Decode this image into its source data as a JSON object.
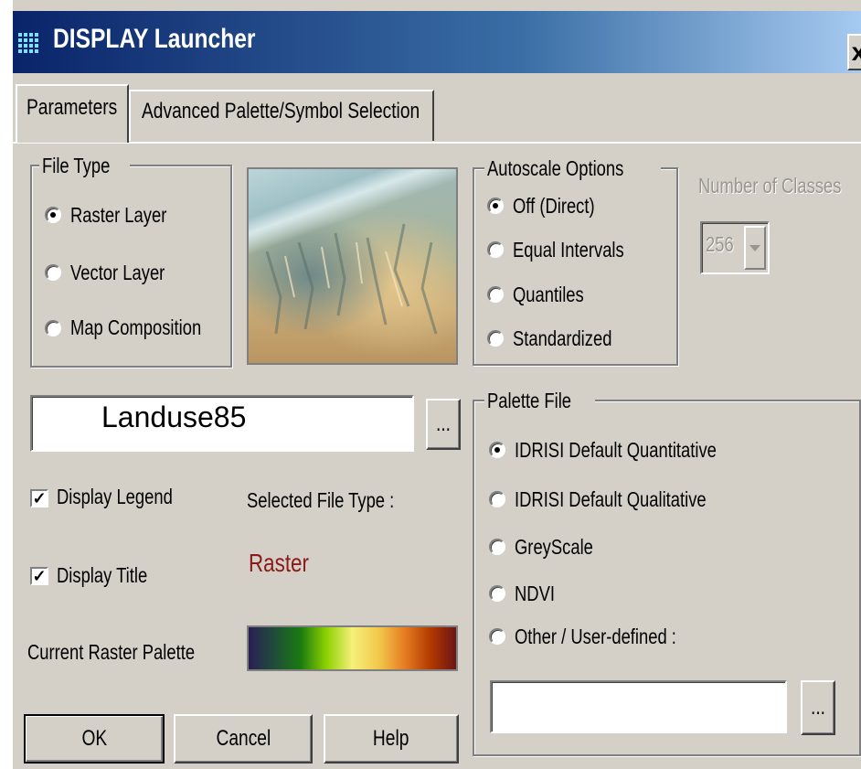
{
  "window": {
    "title": "DISPLAY Launcher",
    "close_label": "x"
  },
  "tabs": [
    {
      "label": "Parameters",
      "active": true
    },
    {
      "label": "Advanced Palette/Symbol Selection",
      "active": false
    }
  ],
  "file_type": {
    "legend": "File Type",
    "options": [
      "Raster Layer",
      "Vector Layer",
      "Map Composition"
    ],
    "selected": "Raster Layer"
  },
  "preview": {
    "icon": "terrain-thumbnail"
  },
  "autoscale": {
    "legend": "Autoscale Options",
    "options": [
      "Off (Direct)",
      "Equal Intervals",
      "Quantiles",
      "Standardized"
    ],
    "selected": "Off (Direct)"
  },
  "classes": {
    "label": "Number of Classes",
    "value": "256",
    "enabled": false
  },
  "file_input": {
    "value": "Landuse85",
    "browse_label": "..."
  },
  "display_legend": {
    "label": "Display Legend",
    "checked": true
  },
  "display_title": {
    "label": "Display Title",
    "checked": true
  },
  "selected_file_type": {
    "label": "Selected File Type :",
    "value": "Raster",
    "color": "#8b1a1a"
  },
  "current_palette": {
    "label": "Current Raster Palette",
    "colors": [
      "#2a1f55",
      "#1f4d3a",
      "#1a7a10",
      "#8cd200",
      "#f5f07a",
      "#f2c94c",
      "#e67e22",
      "#b33a00",
      "#6b1515"
    ]
  },
  "palette_file": {
    "legend": "Palette File",
    "options": [
      "IDRISI Default Quantitative",
      "IDRISI Default Qualitative",
      "GreyScale",
      "NDVI",
      "Other / User-defined :"
    ],
    "selected": "IDRISI Default Quantitative",
    "custom_value": "",
    "browse_label": "..."
  },
  "buttons": {
    "ok": "OK",
    "cancel": "Cancel",
    "help": "Help"
  },
  "colors": {
    "face": "#d4d0c8",
    "title_start": "#0a246a",
    "title_end": "#a6caf0"
  }
}
